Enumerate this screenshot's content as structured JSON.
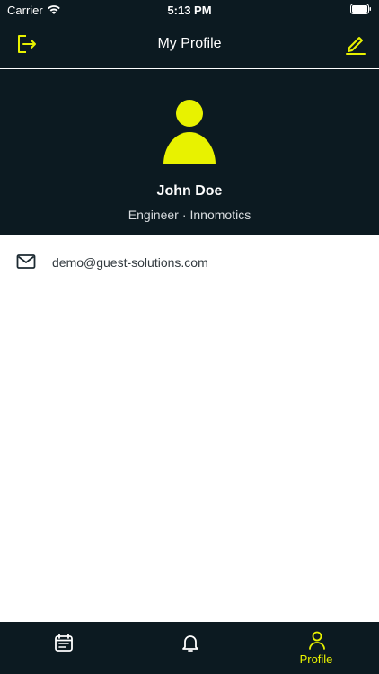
{
  "status_bar": {
    "carrier": "Carrier",
    "time": "5:13 PM"
  },
  "nav": {
    "title": "My Profile",
    "left_icon": "logout-icon",
    "right_icon": "edit-icon"
  },
  "profile": {
    "name": "John Doe",
    "role": "Engineer",
    "separator": "·",
    "company": "Innomotics",
    "avatar_icon": "person-icon"
  },
  "contact": {
    "email_icon": "mail-icon",
    "email": "demo@guest-solutions.com"
  },
  "tabs": [
    {
      "icon": "calendar-icon",
      "label": "",
      "active": false
    },
    {
      "icon": "bell-icon",
      "label": "",
      "active": false
    },
    {
      "icon": "person-icon",
      "label": "Profile",
      "active": true
    }
  ],
  "colors": {
    "accent": "#e8f200",
    "header_bg": "#0c1a21",
    "page_bg": "#ffffff"
  }
}
